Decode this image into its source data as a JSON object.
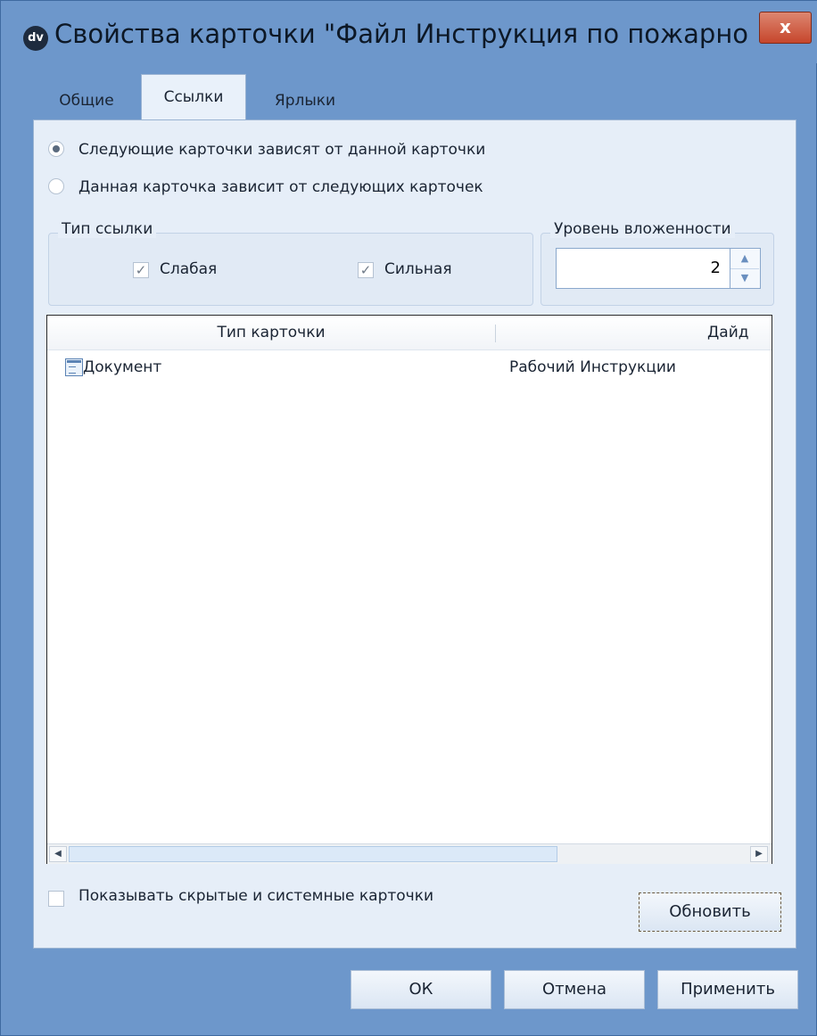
{
  "window": {
    "title": "Свойства карточки \"Файл Инструкция по пожарной б...",
    "app_icon_text": "dv",
    "close_glyph": "x"
  },
  "tabs": [
    {
      "label": "Общие",
      "active": false
    },
    {
      "label": "Ссылки",
      "active": true
    },
    {
      "label": "Ярлыки",
      "active": false
    }
  ],
  "direction": {
    "option1": "Следующие карточки зависят от данной карточки",
    "option2": "Данная карточка зависит от следующих карточек",
    "selected": 1
  },
  "link_type": {
    "legend": "Тип ссылки",
    "weak_label": "Слабая",
    "weak_checked": true,
    "strong_label": "Сильная",
    "strong_checked": true,
    "check_glyph": "✓"
  },
  "nesting": {
    "legend": "Уровень вложенности",
    "value": "2",
    "up_glyph": "▲",
    "down_glyph": "▼"
  },
  "grid": {
    "columns": [
      "Тип карточки",
      "Дайд"
    ],
    "rows": [
      {
        "type": "Документ",
        "icon": "document-card-icon",
        "second": "Рабочий Инструкции"
      }
    ],
    "scroll_left_glyph": "◀",
    "scroll_right_glyph": "▶"
  },
  "show_hidden": {
    "label": "Показывать скрытые и системные карточки",
    "checked": false
  },
  "buttons": {
    "refresh": "Обновить",
    "ok": "ОК",
    "cancel": "Отмена",
    "apply": "Применить"
  },
  "colors": {
    "title_bar": "#6d97cb",
    "close_button": "#c6462c",
    "panel": "#e6eef8"
  }
}
